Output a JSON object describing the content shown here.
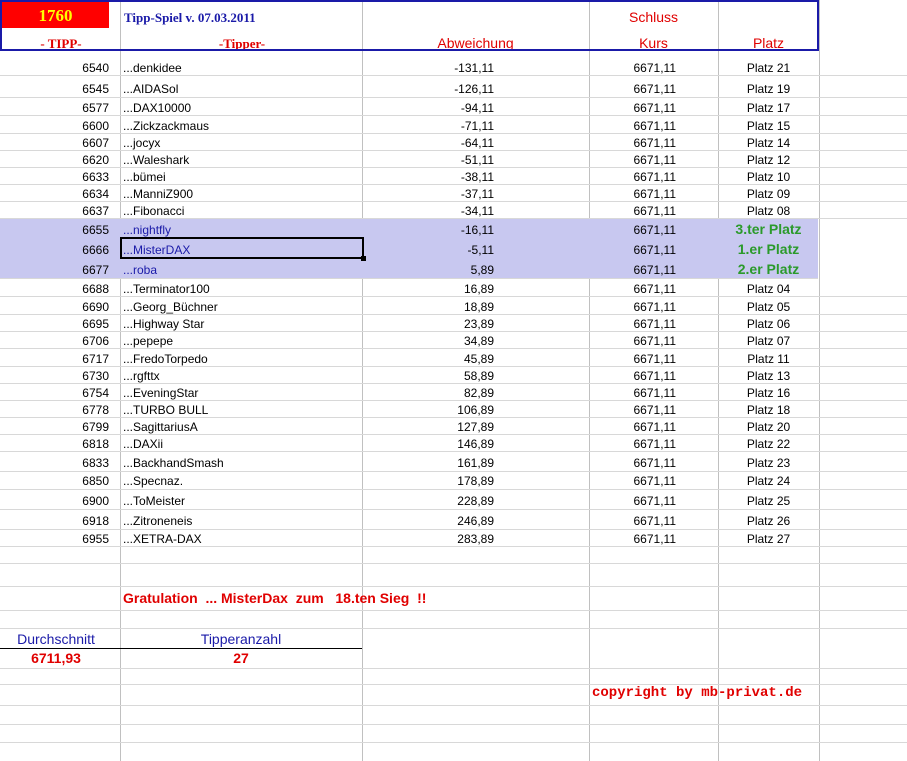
{
  "header": {
    "count": "1760",
    "title": "Tipp-Spiel v. 07.03.2011",
    "schluss": "Schluss",
    "col_tipp": "- TIPP-",
    "col_tipper": "-Tipper-",
    "col_abweichung": "Abweichung",
    "col_kurs": "Kurs",
    "col_platz": "Platz"
  },
  "rows": [
    {
      "tipp": "6540",
      "name": "...denkidee",
      "abw": "-131,11",
      "kurs": "6671,11",
      "platz": "Platz 21"
    },
    {
      "tipp": "6545",
      "name": "...AIDASol",
      "abw": "-126,11",
      "kurs": "6671,11",
      "platz": "Platz 19"
    },
    {
      "tipp": "6577",
      "name": "...DAX10000",
      "abw": "-94,11",
      "kurs": "6671,11",
      "platz": "Platz 17"
    },
    {
      "tipp": "6600",
      "name": "...Zickzackmaus",
      "abw": "-71,11",
      "kurs": "6671,11",
      "platz": "Platz 15"
    },
    {
      "tipp": "6607",
      "name": "...jocyx",
      "abw": "-64,11",
      "kurs": "6671,11",
      "platz": "Platz 14"
    },
    {
      "tipp": "6620",
      "name": "...Waleshark",
      "abw": "-51,11",
      "kurs": "6671,11",
      "platz": "Platz 12"
    },
    {
      "tipp": "6633",
      "name": "...bümei",
      "abw": "-38,11",
      "kurs": "6671,11",
      "platz": "Platz 10"
    },
    {
      "tipp": "6634",
      "name": "...ManniZ900",
      "abw": "-37,11",
      "kurs": "6671,11",
      "platz": "Platz 09"
    },
    {
      "tipp": "6637",
      "name": "...Fibonacci",
      "abw": "-34,11",
      "kurs": "6671,11",
      "platz": "Platz 08"
    },
    {
      "tipp": "6655",
      "name": "...nightfly",
      "abw": "-16,11",
      "kurs": "6671,11",
      "platz": "3.ter Platz"
    },
    {
      "tipp": "6666",
      "name": "...MisterDAX",
      "abw": "-5,11",
      "kurs": "6671,11",
      "platz": "1.er Platz"
    },
    {
      "tipp": "6677",
      "name": "...roba",
      "abw": "5,89",
      "kurs": "6671,11",
      "platz": "2.er Platz"
    },
    {
      "tipp": "6688",
      "name": "...Terminator100",
      "abw": "16,89",
      "kurs": "6671,11",
      "platz": "Platz 04"
    },
    {
      "tipp": "6690",
      "name": "...Georg_Büchner",
      "abw": "18,89",
      "kurs": "6671,11",
      "platz": "Platz 05"
    },
    {
      "tipp": "6695",
      "name": "...Highway Star",
      "abw": "23,89",
      "kurs": "6671,11",
      "platz": "Platz 06"
    },
    {
      "tipp": "6706",
      "name": "...pepepe",
      "abw": "34,89",
      "kurs": "6671,11",
      "platz": "Platz 07"
    },
    {
      "tipp": "6717",
      "name": "...FredoTorpedo",
      "abw": "45,89",
      "kurs": "6671,11",
      "platz": "Platz 11"
    },
    {
      "tipp": "6730",
      "name": "...rgfttx",
      "abw": "58,89",
      "kurs": "6671,11",
      "platz": "Platz 13"
    },
    {
      "tipp": "6754",
      "name": "...EveningStar",
      "abw": "82,89",
      "kurs": "6671,11",
      "platz": "Platz 16"
    },
    {
      "tipp": "6778",
      "name": "...TURBO BULL",
      "abw": "106,89",
      "kurs": "6671,11",
      "platz": "Platz 18"
    },
    {
      "tipp": "6799",
      "name": "...SagittariusA",
      "abw": "127,89",
      "kurs": "6671,11",
      "platz": "Platz 20"
    },
    {
      "tipp": "6818",
      "name": "...DAXii",
      "abw": "146,89",
      "kurs": "6671,11",
      "platz": "Platz 22"
    },
    {
      "tipp": "6833",
      "name": "...BackhandSmash",
      "abw": "161,89",
      "kurs": "6671,11",
      "platz": "Platz 23"
    },
    {
      "tipp": "6850",
      "name": "...Specnaz.",
      "abw": "178,89",
      "kurs": "6671,11",
      "platz": "Platz 24"
    },
    {
      "tipp": "6900",
      "name": "...ToMeister",
      "abw": "228,89",
      "kurs": "6671,11",
      "platz": "Platz 25"
    },
    {
      "tipp": "6918",
      "name": "...Zitroneneis",
      "abw": "246,89",
      "kurs": "6671,11",
      "platz": "Platz 26"
    },
    {
      "tipp": "6955",
      "name": "...XETRA-DAX",
      "abw": "283,89",
      "kurs": "6671,11",
      "platz": "Platz 27"
    }
  ],
  "footer": {
    "gratulation": "Gratulation  ... MisterDax  zum   18.ten Sieg  !!",
    "durchschnitt_label": "Durchschnitt",
    "durchschnitt_value": "6711,93",
    "tipperanzahl_label": "Tipperanzahl",
    "tipperanzahl_value": "27",
    "copyright": "copyright by mb-privat.de"
  },
  "colors": {
    "header_red": "#e00000",
    "header_blue": "#1a1aa8",
    "count_bg": "#ff0000",
    "count_fg": "#ffff00",
    "highlight": "#c8c8f0",
    "top3_green": "#2b9a2b"
  }
}
